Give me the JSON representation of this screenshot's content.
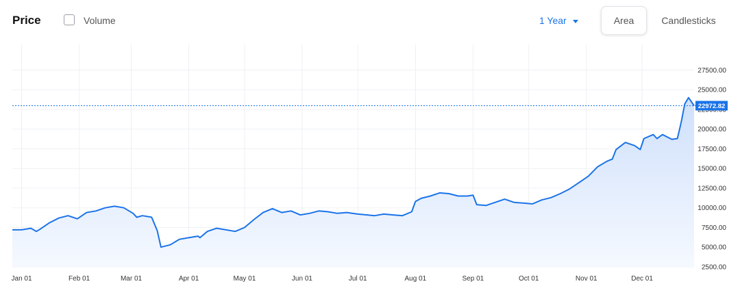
{
  "toolbar": {
    "title": "Price",
    "volume_label": "Volume",
    "volume_checked": false,
    "range_label": "1 Year",
    "area_label": "Area",
    "candlesticks_label": "Candlesticks",
    "selected_view": "Area"
  },
  "colors": {
    "line": "#1a73e8",
    "area_fill_top": "#cfe0fb",
    "area_fill_bottom": "#f5f9ff",
    "grid": "#eef0f3",
    "price_badge": "#1a73e8"
  },
  "chart_data": {
    "type": "area",
    "title": "",
    "xlabel": "",
    "ylabel": "",
    "x_ticks": [
      "Jan 01",
      "Feb 01",
      "Mar 01",
      "Apr 01",
      "May 01",
      "Jun 01",
      "Jul 01",
      "Aug 01",
      "Sep 01",
      "Oct 01",
      "Nov 01",
      "Dec 01"
    ],
    "y_ticks": [
      "2500.00",
      "5000.00",
      "7500.00",
      "10000.00",
      "12500.00",
      "15000.00",
      "17500.00",
      "20000.00",
      "22500.00",
      "25000.00",
      "27500.00"
    ],
    "ylim": [
      2500,
      27500
    ],
    "xlim": [
      -5,
      362
    ],
    "grid": true,
    "y_axis_side": "right",
    "current_price": 22972.82,
    "current_price_label": "22972.82",
    "series": [
      {
        "x": [
          -5,
          0,
          5,
          8,
          10,
          15,
          20,
          25,
          30,
          35,
          40,
          45,
          50,
          55,
          60,
          62,
          65,
          70,
          73,
          75,
          80,
          85,
          90,
          95,
          96,
          100,
          105,
          110,
          115,
          120,
          125,
          130,
          135,
          140,
          145,
          150,
          155,
          160,
          165,
          170,
          175,
          181,
          186,
          190,
          195,
          200,
          205,
          210,
          212,
          215,
          220,
          225,
          230,
          235,
          240,
          243,
          245,
          250,
          255,
          260,
          265,
          270,
          275,
          280,
          285,
          290,
          295,
          300,
          305,
          310,
          315,
          318,
          320,
          325,
          330,
          333,
          335,
          340,
          342,
          345,
          350,
          353,
          355,
          357,
          359,
          362
        ],
        "y": [
          7200,
          7200,
          7400,
          7000,
          7300,
          8100,
          8700,
          9000,
          8600,
          9400,
          9600,
          10000,
          10200,
          10000,
          9300,
          8800,
          9000,
          8800,
          7100,
          5000,
          5300,
          6000,
          6200,
          6400,
          6200,
          7000,
          7400,
          7200,
          7000,
          7500,
          8500,
          9400,
          9900,
          9400,
          9600,
          9100,
          9300,
          9600,
          9500,
          9300,
          9400,
          9200,
          9100,
          9000,
          9200,
          9100,
          9000,
          9500,
          10800,
          11200,
          11500,
          11900,
          11800,
          11500,
          11500,
          11600,
          10400,
          10300,
          10700,
          11100,
          10700,
          10600,
          10500,
          11000,
          11300,
          11800,
          12400,
          13200,
          14000,
          15200,
          15900,
          16200,
          17400,
          18300,
          17900,
          17400,
          18800,
          19300,
          18800,
          19300,
          18700,
          18800,
          20800,
          23200,
          24000,
          22972.82
        ]
      }
    ]
  }
}
